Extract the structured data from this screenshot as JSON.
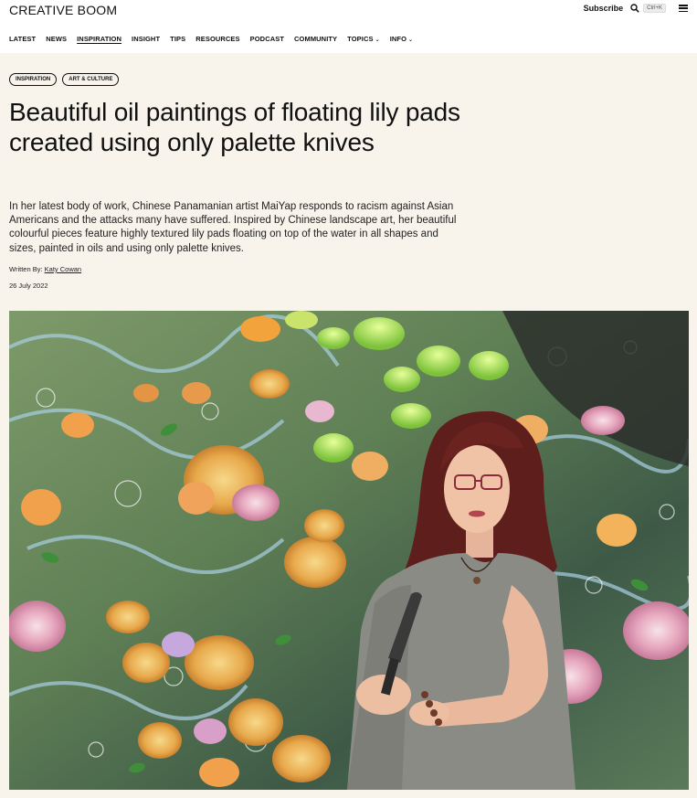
{
  "header": {
    "logo": "CREATIVE BOOM",
    "subscribe_label": "Subscribe",
    "search_shortcut": "Ctrl+K"
  },
  "nav": {
    "items": [
      {
        "label": "LATEST"
      },
      {
        "label": "NEWS"
      },
      {
        "label": "INSPIRATION"
      },
      {
        "label": "INSIGHT"
      },
      {
        "label": "TIPS"
      },
      {
        "label": "RESOURCES"
      },
      {
        "label": "PODCAST"
      },
      {
        "label": "COMMUNITY"
      },
      {
        "label": "TOPICS"
      },
      {
        "label": "INFO"
      }
    ]
  },
  "article": {
    "tags": [
      "INSPIRATION",
      "ART & CULTURE"
    ],
    "title": "Beautiful oil paintings of floating lily pads created using only palette knives",
    "standfirst": "In her latest body of work, Chinese Panamanian artist MaiYap responds to racism against Asian Americans and the attacks many have suffered. Inspired by Chinese landscape art, her beautiful colourful pieces feature highly textured lily pads floating on top of the water in all shapes and sizes, painted in oils and using only palette knives.",
    "byline_prefix": "Written By:",
    "author": "Katy Cowan",
    "date": "26 July 2022"
  },
  "colors": {
    "hero_background": "#f8f4ec",
    "text": "#111111"
  }
}
